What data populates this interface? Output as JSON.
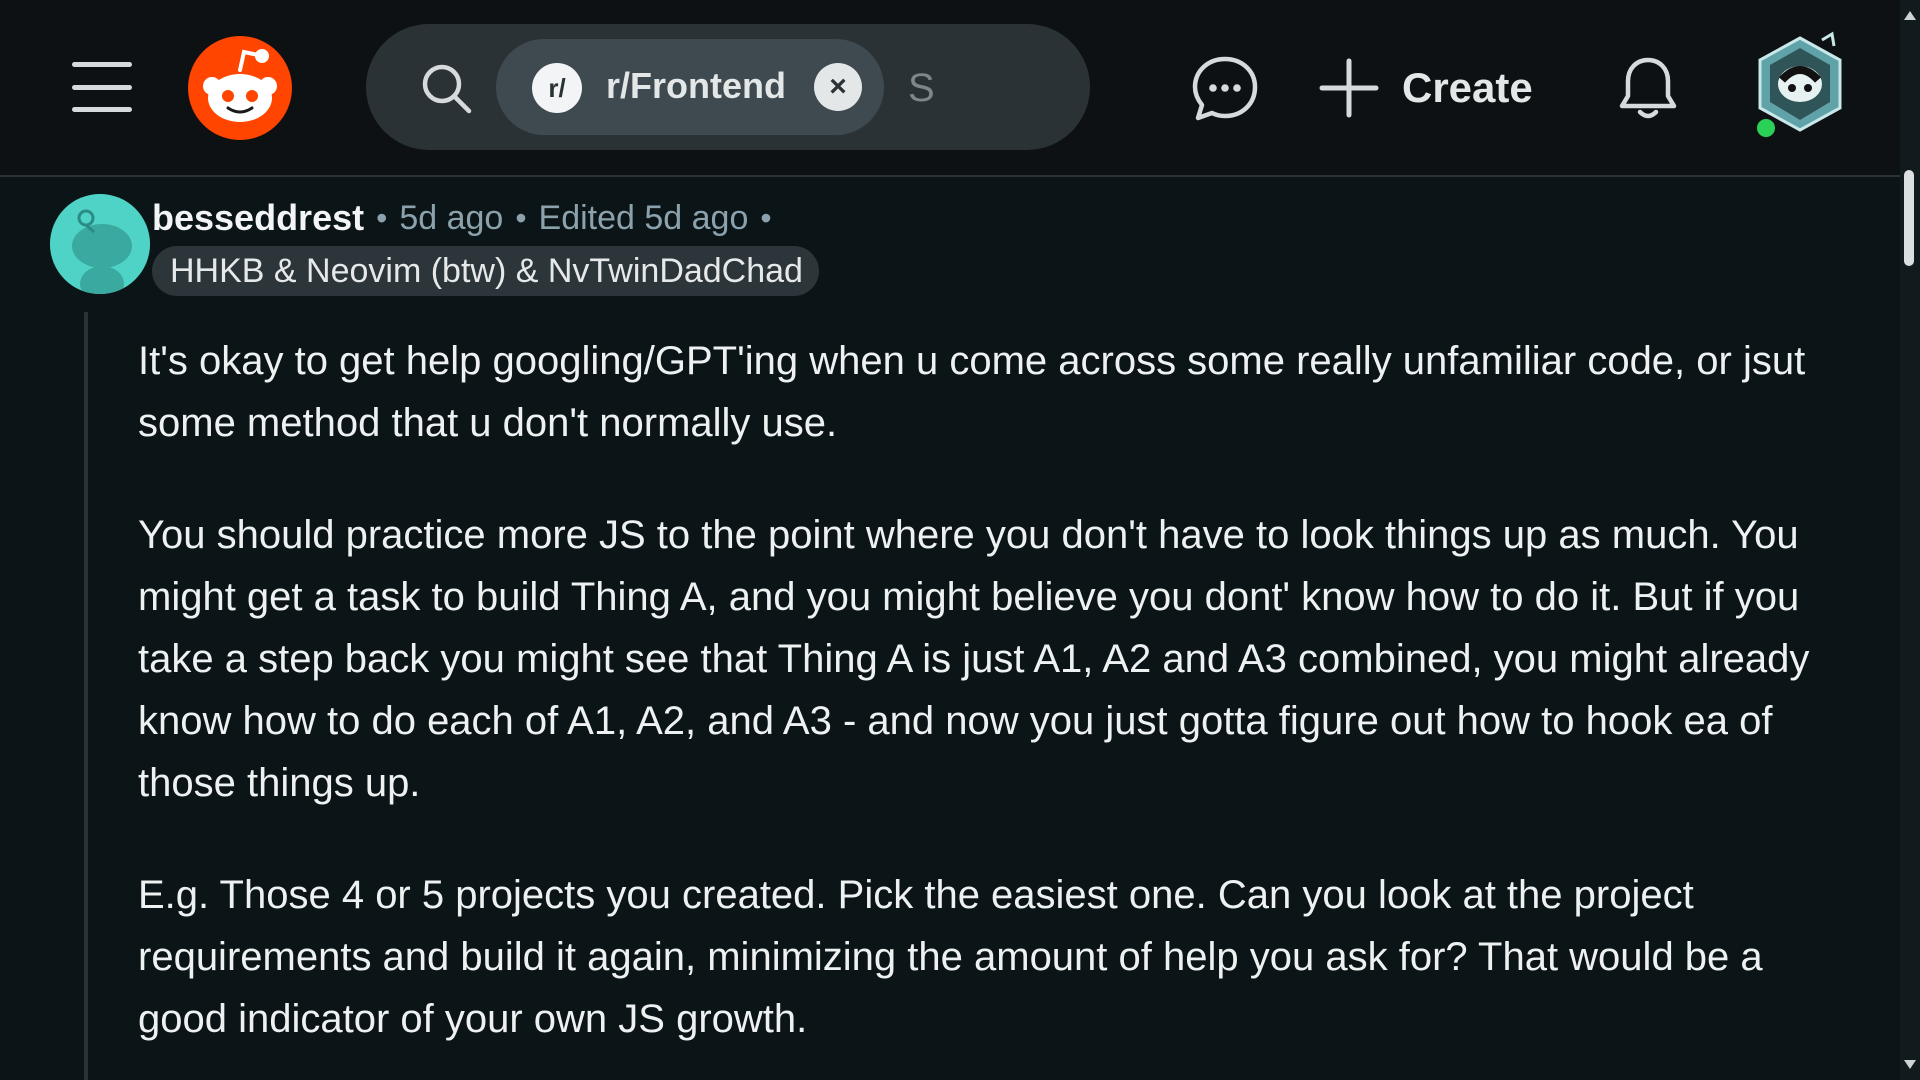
{
  "header": {
    "search": {
      "community_badge": "r/",
      "community_chip": "r/Frontend",
      "placeholder": "S"
    },
    "create_label": "Create",
    "icons": {
      "menu": "hamburger-icon",
      "logo": "reddit-logo",
      "search": "search-icon",
      "chip_remove": "close-icon",
      "chat": "chat-icon",
      "create": "plus-icon",
      "notifications": "bell-icon",
      "profile": "user-avatar"
    },
    "colors": {
      "logo": "#ff4500",
      "online": "#2bd157"
    }
  },
  "comment": {
    "username": "besseddrest",
    "sep1": "•",
    "posted": "5d ago",
    "sep2": "•",
    "edited": "Edited 5d ago",
    "sep3": "•",
    "flair": "HHKB & Neovim (btw) & NvTwinDadChad",
    "avatar_color": "#4fd3c7",
    "paragraphs": [
      "It's okay to get help googling/GPT'ing when u come across some really unfamiliar code, or jsut some method that u don't normally use.",
      "You should practice more JS to the point where you don't have to look things up as much. You might get a task to build Thing A, and you might believe you dont' know how to do it. But if you take a step back you might see that Thing A is just A1, A2 and A3 combined, you might already know how to do each of A1, A2, and A3 - and now you just gotta figure out how to hook ea of those things up.",
      "E.g. Those 4 or 5 projects you created. Pick the easiest one. Can you look at the project requirements and build it again, minimizing the amount of help you ask for? That would be a good indicator of your own JS growth."
    ]
  }
}
